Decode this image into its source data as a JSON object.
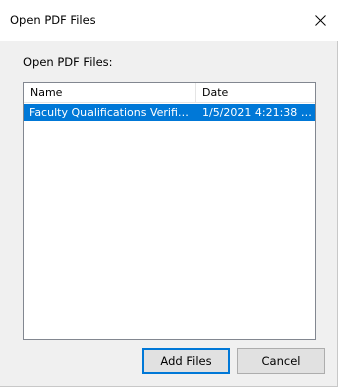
{
  "window": {
    "title": "Open PDF Files",
    "close_icon": "close-icon"
  },
  "section": {
    "label": "Open PDF Files:"
  },
  "file_list": {
    "columns": [
      "Name",
      "Date"
    ],
    "rows": [
      {
        "name": "Faculty Qualifications Verific...",
        "date": "1/5/2021 4:21:38 PM",
        "selected": true
      }
    ]
  },
  "buttons": {
    "add_files": "Add Files",
    "cancel": "Cancel"
  },
  "colors": {
    "selection": "#0078d7",
    "dialog_bg": "#f0f0f0",
    "list_border": "#828790"
  }
}
